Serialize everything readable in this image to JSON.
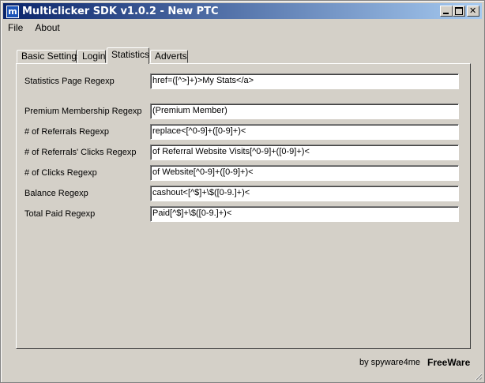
{
  "window": {
    "title": "Multiclicker SDK v1.0.2 - New PTC",
    "icon": "app-icon"
  },
  "menu": {
    "items": [
      "File",
      "About"
    ]
  },
  "tabs": [
    "Basic Settings",
    "Login",
    "Statistics",
    "Adverts"
  ],
  "active_tab": "Statistics",
  "fields": [
    {
      "label": "Statistics Page Regexp",
      "value": "href=([^>]+)>My Stats</a>"
    },
    {
      "label": "Premium Membership Regexp",
      "value": "(Premium Member)"
    },
    {
      "label": "# of Referrals Regexp",
      "value": "replace<[^0-9]+([0-9]+)<"
    },
    {
      "label": "# of Referrals' Clicks Regexp",
      "value": "of Referral Website Visits[^0-9]+([0-9]+)<"
    },
    {
      "label": "# of Clicks Regexp",
      "value": "of Website[^0-9]+([0-9]+)<"
    },
    {
      "label": "Balance Regexp",
      "value": "cashout<[^$]+\\$([0-9.]+)<"
    },
    {
      "label": "Total Paid Regexp",
      "value": "Paid[^$]+\\$([0-9.]+)<"
    }
  ],
  "footer": {
    "by": "by spyware4me",
    "freeware": "FreeWare"
  },
  "colors": {
    "titlebar_start": "#0a246a",
    "titlebar_end": "#a6caf0",
    "face": "#d4d0c8"
  }
}
